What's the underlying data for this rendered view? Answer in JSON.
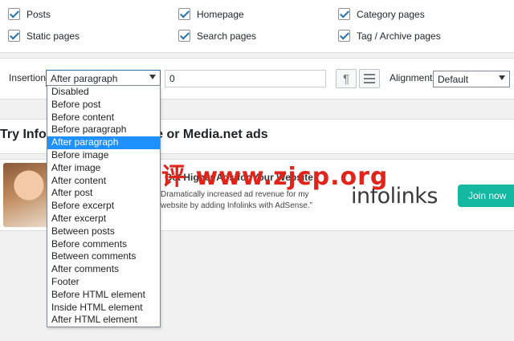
{
  "checkboxes": [
    {
      "label": "Posts",
      "checked": true
    },
    {
      "label": "Homepage",
      "checked": true
    },
    {
      "label": "Category pages",
      "checked": true
    },
    {
      "label": "Static pages",
      "checked": true
    },
    {
      "label": "Search pages",
      "checked": true
    },
    {
      "label": "Tag / Archive pages",
      "checked": true
    }
  ],
  "insertion": {
    "label": "Insertion",
    "selected": "After paragraph",
    "number_value": "0",
    "paragraph_button_icon": "pilcrow-icon",
    "list_button_icon": "list-icon",
    "alignment_label": "Alignment",
    "alignment_selected": "Default",
    "options": [
      "Disabled",
      "Before post",
      "Before content",
      "Before paragraph",
      "After paragraph",
      "Before image",
      "After image",
      "After content",
      "After post",
      "Before excerpt",
      "After excerpt",
      "Between posts",
      "Before comments",
      "Between comments",
      "After comments",
      "Footer",
      "Before HTML element",
      "Inside HTML element",
      "After HTML element"
    ]
  },
  "ad_section": {
    "heading": "Try Infolinks with AdSense or Media.net ads",
    "banner_title": "Get Higher Ads for Your Website",
    "banner_line1": "Dramatically increased ad revenue for my",
    "banner_line2": "website by adding Infolinks with AdSense.”",
    "brand_logo_text": "infolinks",
    "join_button_label": "Join now"
  },
  "watermark": "主机测评 www.zjcp.org",
  "colors": {
    "accent": "#2271b1",
    "selected_option": "#1e90ff",
    "join_button": "#14b8a0",
    "watermark": "#e2231a"
  }
}
